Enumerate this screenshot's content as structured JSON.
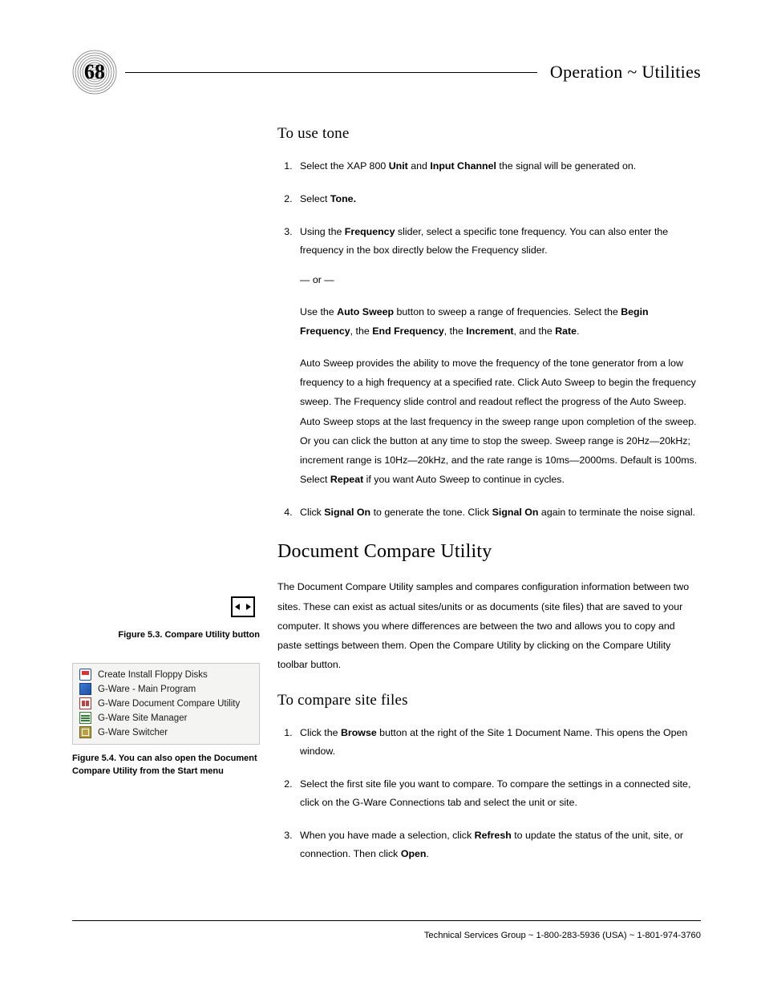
{
  "page_number": "68",
  "header_title_prefix": "Operation",
  "header_title_sep": " ~ ",
  "header_title_suffix": "Utilities",
  "subheading_tone": "To use tone",
  "steps_tone": {
    "s1_pre": "Select the XAP 800 ",
    "s1_b1": "Unit",
    "s1_mid": " and ",
    "s1_b2": "Input Channel",
    "s1_post": " the signal will be generated on.",
    "s2_pre": "Select ",
    "s2_b1": "Tone.",
    "s3_pre": "Using the ",
    "s3_b1": "Frequency",
    "s3_mid": " slider, select a specific tone frequency. You can also enter the frequency in the box directly below the Frequency slider.",
    "s3_or": "— or —",
    "s3_p2_pre": "Use the ",
    "s3_p2_b1": "Auto Sweep",
    "s3_p2_mid1": " button to sweep a range of frequencies. Select the ",
    "s3_p2_b2": "Begin Frequency",
    "s3_p2_mid2": ", the ",
    "s3_p2_b3": "End Frequency",
    "s3_p2_mid3": ", the ",
    "s3_p2_b4": "Increment",
    "s3_p2_mid4": ", and the ",
    "s3_p2_b5": "Rate",
    "s3_p2_end": ".",
    "s3_p3_a": "Auto Sweep provides the ability to move the frequency of the tone generator from a low frequency to a high frequency at a specified rate. Click Auto Sweep to begin the frequency sweep. The Frequency slide control and readout reflect the progress of the Auto Sweep. Auto Sweep stops at the last frequency in the sweep range upon completion of the sweep. Or you can click the button at any time to stop the sweep. Sweep range is 20Hz—20kHz; increment range is 10Hz—20kHz, and the rate range is 10ms—2000ms. Default is 100ms. Select ",
    "s3_p3_b1": "Repeat",
    "s3_p3_b": " if you want Auto Sweep to continue in cycles.",
    "s4_pre": "Click ",
    "s4_b1": "Signal On",
    "s4_mid": " to generate the tone. Click ",
    "s4_b2": "Signal On",
    "s4_post": " again to terminate the noise signal."
  },
  "section_title_compare": "Document Compare Utility",
  "compare_intro": "The Document Compare Utility samples and compares configuration information between two sites. These can exist as actual sites/units or as documents (site files) that are saved to your computer. It shows you where differences are between the two and allows you to copy and paste settings between them. Open the Compare Utility by clicking on the Compare Utility toolbar button.",
  "subheading_compare": "To compare site files",
  "steps_compare": {
    "c1_pre": "Click the ",
    "c1_b1": "Browse",
    "c1_post": " button at the right of the Site 1 Document Name. This opens the Open window.",
    "c2": "Select the first site file you want to compare. To compare the settings in a connected site, click on the G-Ware Connections tab and select the unit or site.",
    "c3_pre": "When you have made a selection, click ",
    "c3_b1": "Refresh",
    "c3_mid": " to update the status of the unit, site, or connection. Then click ",
    "c3_b2": "Open",
    "c3_end": "."
  },
  "fig53_caption": "Figure 5.3. Compare Utility button",
  "startmenu_items": [
    "Create Install Floppy Disks",
    "G-Ware - Main Program",
    "G-Ware Document Compare Utility",
    "G-Ware Site Manager",
    "G-Ware Switcher"
  ],
  "fig54_caption": "Figure 5.4. You can also open the Document Compare Utility from the Start menu",
  "footer_prefix": "Technical Services Group",
  "footer_sep1": " ~ ",
  "footer_phone1": "1-800-283-5936 (USA)",
  "footer_sep2": " ~ ",
  "footer_phone2": "1-801-974-3760"
}
